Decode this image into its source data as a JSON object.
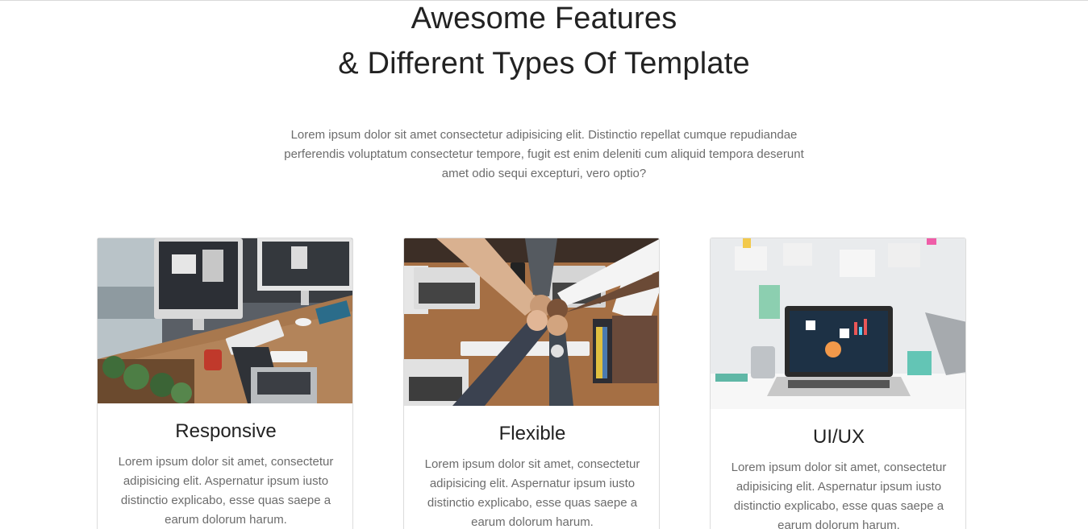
{
  "section": {
    "heading_line1": "Awesome Features",
    "heading_line2": "& Different Types Of Template",
    "intro": "Lorem ipsum dolor sit amet consectetur adipisicing elit. Distinctio repellat cumque repudiandae perferendis voluptatum consectetur tempore, fugit est enim deleniti cum aliquid tempora deserunt amet odio sequi excepturi, vero optio?"
  },
  "cards": [
    {
      "title": "Responsive",
      "text": "Lorem ipsum dolor sit amet, consectetur adipisicing elit. Aspernatur ipsum iusto distinctio explicabo, esse quas saepe a earum dolorum harum.",
      "image": "desk-with-imac-and-laptop-photo"
    },
    {
      "title": "Flexible",
      "text": "Lorem ipsum dolor sit amet, consectetur adipisicing elit. Aspernatur ipsum iusto distinctio explicabo, esse quas saepe a earum dolorum harum.",
      "image": "team-fist-bump-over-laptops-photo"
    },
    {
      "title": "UI/UX",
      "text": "Lorem ipsum dolor sit amet, consectetur adipisicing elit. Aspernatur ipsum iusto distinctio explicabo, esse quas saepe a earum dolorum harum.",
      "image": "laptop-with-dashboard-on-desk-photo"
    }
  ],
  "colors": {
    "heading": "#222222",
    "body_text": "#6c6c6c",
    "card_border": "#dcdcdc"
  }
}
